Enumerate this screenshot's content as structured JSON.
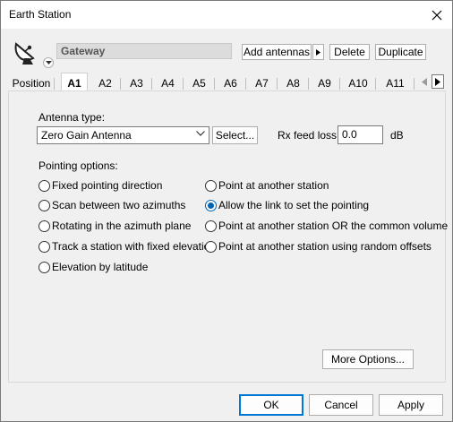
{
  "window": {
    "title": "Earth Station"
  },
  "header": {
    "name_value": "Gateway",
    "add_antennas_label": "Add antennas",
    "delete_label": "Delete",
    "duplicate_label": "Duplicate"
  },
  "tabs": [
    "Position",
    "A1",
    "A2",
    "A3",
    "A4",
    "A5",
    "A6",
    "A7",
    "A8",
    "A9",
    "A10",
    "A11"
  ],
  "active_tab": "A1",
  "antenna": {
    "type_label": "Antenna type:",
    "type_value": "Zero Gain Antenna",
    "select_label": "Select...",
    "rx_feed_loss_label": "Rx feed loss:",
    "rx_feed_loss_value": "0.0",
    "rx_feed_loss_unit": "dB"
  },
  "pointing": {
    "label": "Pointing options:",
    "options_left": [
      "Fixed pointing direction",
      "Scan between two azimuths",
      "Rotating in the azimuth plane",
      "Track a station with fixed elevation",
      "Elevation by latitude"
    ],
    "options_right": [
      "Point at another station",
      "Allow the link to set the pointing",
      "Point at another station OR the common volume",
      "Point at another station using random offsets"
    ],
    "selected": "Allow the link to set the pointing"
  },
  "more_options_label": "More Options...",
  "footer": {
    "ok": "OK",
    "cancel": "Cancel",
    "apply": "Apply"
  },
  "colors": {
    "accent": "#0078d7",
    "radio_checked": "#0063b1",
    "dialog_bg": "#f0f0f0"
  }
}
